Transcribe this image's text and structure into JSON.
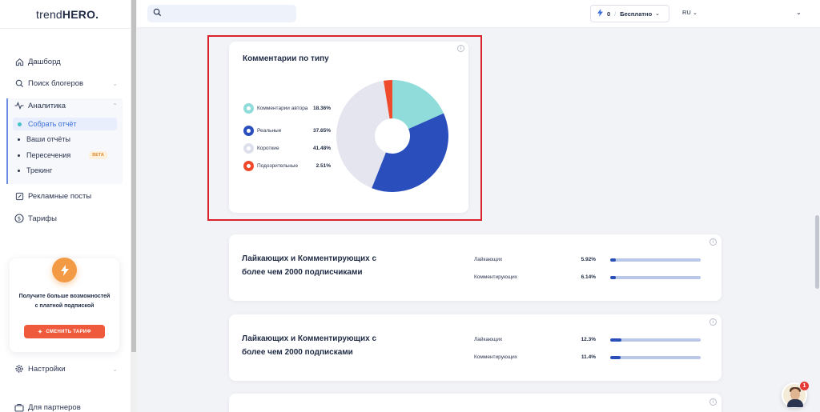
{
  "brand": {
    "logo_light": "trend",
    "logo_bold": "HERO",
    "logo_dot": "."
  },
  "sidebar": {
    "items": [
      {
        "label": "Дашборд",
        "icon": "home-icon"
      },
      {
        "label": "Поиск блогеров",
        "icon": "search-icon"
      },
      {
        "label": "Аналитика",
        "icon": "analytics-icon"
      },
      {
        "label": "Рекламные посты",
        "icon": "ad-post-icon"
      },
      {
        "label": "Тарифы",
        "icon": "tariff-icon"
      },
      {
        "label": "Настройки",
        "icon": "gear-icon"
      },
      {
        "label": "Для партнеров",
        "icon": "partners-icon"
      }
    ],
    "analytics_sub": [
      {
        "label": "Собрать отчёт",
        "active": true
      },
      {
        "label": "Ваши отчёты"
      },
      {
        "label": "Пересечения",
        "badge": "BETA"
      },
      {
        "label": "Трекинг"
      }
    ],
    "promo": {
      "text": "Получите больше возможностей с платной подпиской",
      "button": "СМЕНИТЬ ТАРИФ"
    }
  },
  "topbar": {
    "search_placeholder": "",
    "credits": "0",
    "plan": "Бесплатно",
    "language": "RU"
  },
  "comments_card": {
    "title": "Комментарии по типу",
    "legend": [
      {
        "label": "Комментарии автора",
        "percent": "18.36%",
        "value": 18.36,
        "color": "#8fdcdb"
      },
      {
        "label": "Реальные",
        "percent": "37.65%",
        "value": 37.65,
        "color": "#2a4fbd"
      },
      {
        "label": "Короткие",
        "percent": "41.48%",
        "value": 41.48,
        "color": "#e4e5ef"
      },
      {
        "label": "Подозрительные",
        "percent": "2.51%",
        "value": 2.51,
        "color": "#ef4a2c"
      }
    ]
  },
  "metrics": [
    {
      "title": "Лайкающих и Комментирующих с более чем 2000 подписчиками",
      "rows": [
        {
          "label": "Лайкающих",
          "value": "5.92%",
          "fraction": 0.0592
        },
        {
          "label": "Комментирующих",
          "value": "6.14%",
          "fraction": 0.0614
        }
      ]
    },
    {
      "title": "Лайкающих и Комментирующих с более чем 2000 подписками",
      "rows": [
        {
          "label": "Лайкающих",
          "value": "12.3%",
          "fraction": 0.123
        },
        {
          "label": "Комментирующих",
          "value": "11.4%",
          "fraction": 0.114
        }
      ]
    }
  ],
  "chat": {
    "notifications": "1"
  }
}
